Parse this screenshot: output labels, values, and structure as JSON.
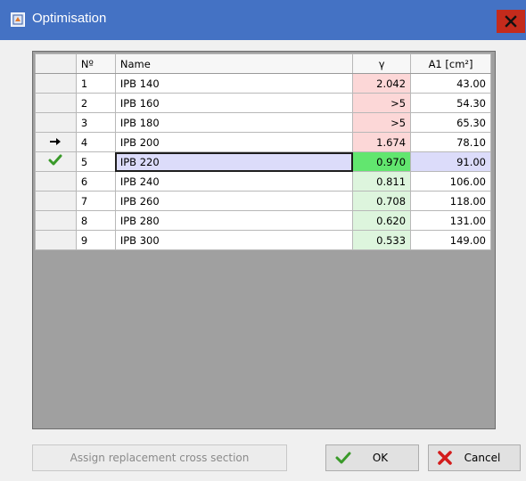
{
  "window": {
    "title": "Optimisation",
    "icon": "app-icon",
    "close_icon": "close-icon"
  },
  "grid": {
    "columns": [
      "",
      "Nº",
      "Name",
      "γ",
      "A1 [cm²]"
    ],
    "rows": [
      {
        "indicator": "",
        "no": "1",
        "name": "IPB 140",
        "gamma": "2.042",
        "a1": "43.00"
      },
      {
        "indicator": "",
        "no": "2",
        "name": "IPB 160",
        "gamma": ">5",
        "a1": "54.30"
      },
      {
        "indicator": "",
        "no": "3",
        "name": "IPB 180",
        "gamma": ">5",
        "a1": "65.30"
      },
      {
        "indicator": "arrow-right-icon",
        "no": "4",
        "name": "IPB 200",
        "gamma": "1.674",
        "a1": "78.10"
      },
      {
        "indicator": "checkmark-icon",
        "no": "5",
        "name": "IPB 220",
        "gamma": "0.970",
        "a1": "91.00"
      },
      {
        "indicator": "",
        "no": "6",
        "name": "IPB 240",
        "gamma": "0.811",
        "a1": "106.00"
      },
      {
        "indicator": "",
        "no": "7",
        "name": "IPB 260",
        "gamma": "0.708",
        "a1": "118.00"
      },
      {
        "indicator": "",
        "no": "8",
        "name": "IPB 280",
        "gamma": "0.620",
        "a1": "131.00"
      },
      {
        "indicator": "",
        "no": "9",
        "name": "IPB 300",
        "gamma": "0.533",
        "a1": "149.00"
      }
    ],
    "colors": {
      "gamma_over": "#fcd7d7",
      "gamma_ok": "#ddf5dd",
      "gamma_selected": "#62e66f",
      "selected_row": "#dcdcfa"
    }
  },
  "buttons": {
    "assign_label": "Assign replacement cross section",
    "ok_label": "OK",
    "cancel_label": "Cancel"
  }
}
